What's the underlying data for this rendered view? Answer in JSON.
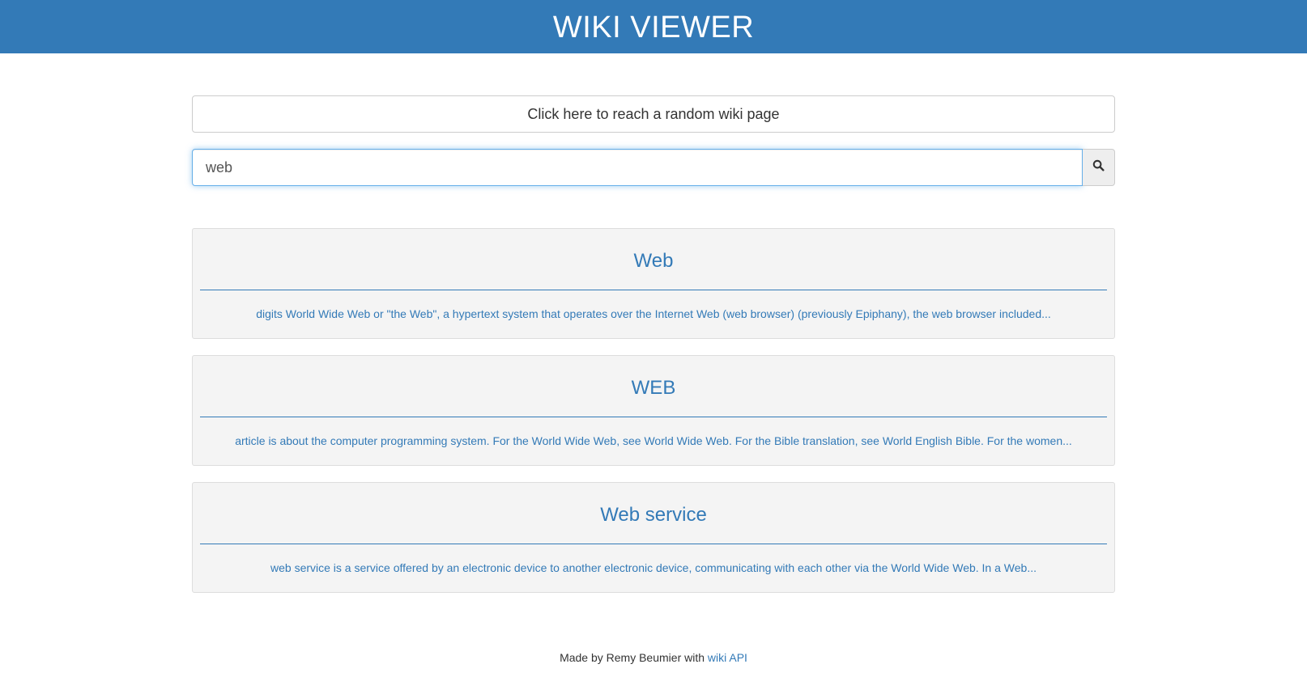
{
  "header": {
    "title": "WIKI VIEWER"
  },
  "random": {
    "label": "Click here to reach a random wiki page"
  },
  "search": {
    "value": "web",
    "icon": "search-icon"
  },
  "results": [
    {
      "title": "Web",
      "snippet": "digits World Wide Web or \"the Web\", a hypertext system that operates over the Internet Web (web browser) (previously Epiphany), the web browser included..."
    },
    {
      "title": "WEB",
      "snippet": "article is about the computer programming system. For the World Wide Web, see World Wide Web. For the Bible translation, see World English Bible. For the women..."
    },
    {
      "title": "Web service",
      "snippet": "web service is a service offered by an electronic device to another electronic device, communicating with each other via the World Wide Web. In a Web..."
    }
  ],
  "footer": {
    "prefix": "Made by Remy Beumier with",
    "link_label": "wiki API"
  },
  "colors": {
    "brand": "#337ab7",
    "card_bg": "#f4f4f4"
  }
}
